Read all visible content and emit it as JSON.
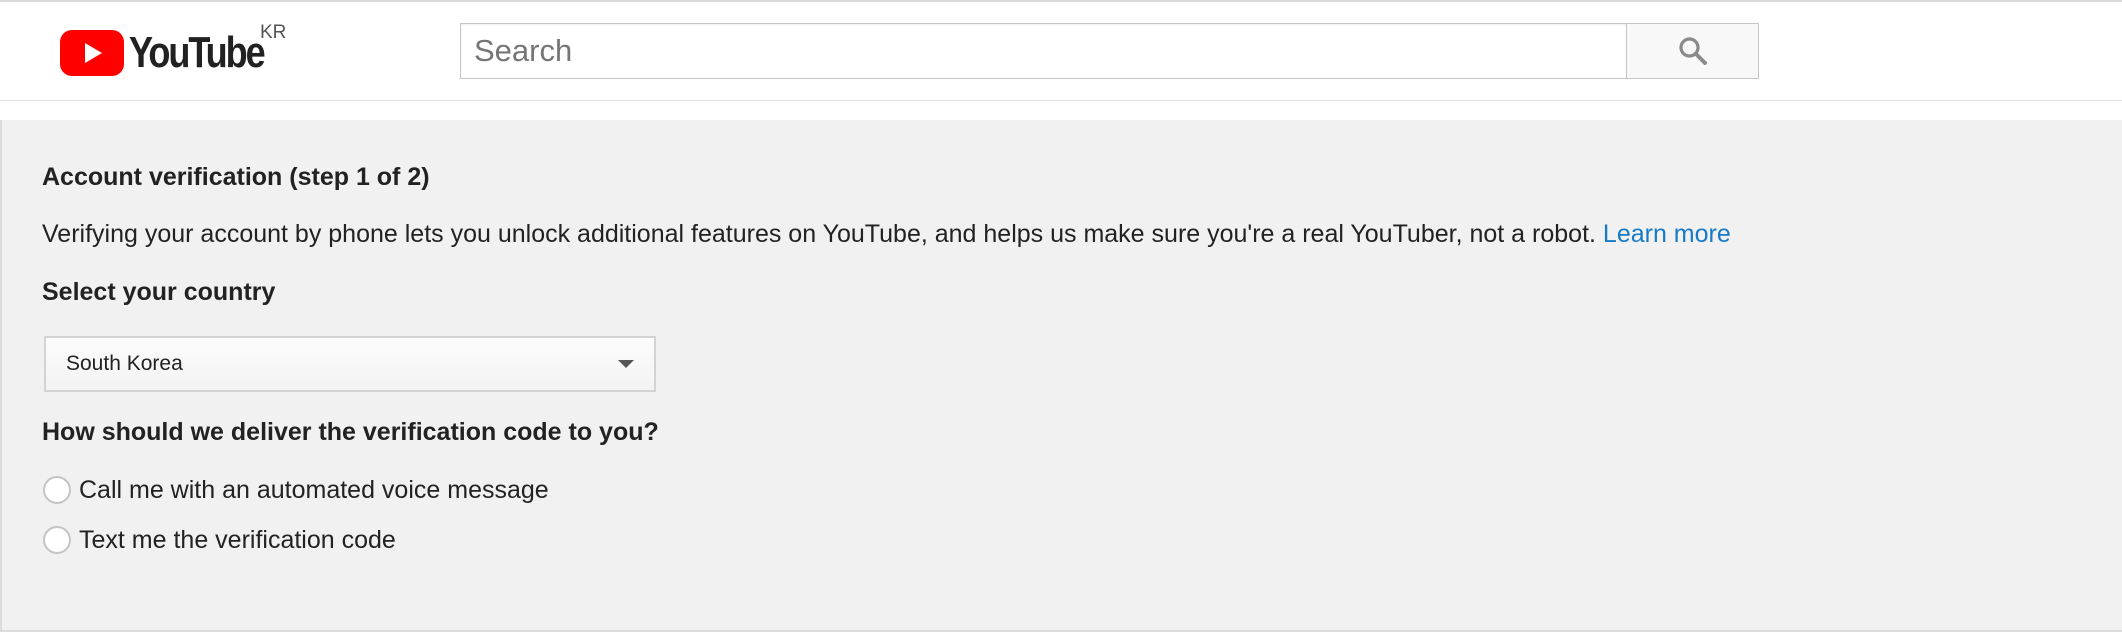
{
  "header": {
    "logo_text": "YouTube",
    "country_code": "KR",
    "search": {
      "placeholder": "Search",
      "value": ""
    },
    "search_button_icon": "magnifier-icon"
  },
  "verification": {
    "heading": "Account verification (step 1 of 2)",
    "description": "Verifying your account by phone lets you unlock additional features on YouTube, and helps us make sure you're a real YouTuber, not a robot.",
    "learn_more_label": "Learn more",
    "country_label": "Select your country",
    "selected_country": "South Korea",
    "delivery_question": "How should we deliver the verification code to you?",
    "delivery_options": [
      {
        "label": "Call me with an automated voice message",
        "selected": false
      },
      {
        "label": "Text me the verification code",
        "selected": false
      }
    ]
  },
  "colors": {
    "brand_red": "#ff0000",
    "link_blue": "#167ac6",
    "content_background": "#f1f1f1"
  }
}
